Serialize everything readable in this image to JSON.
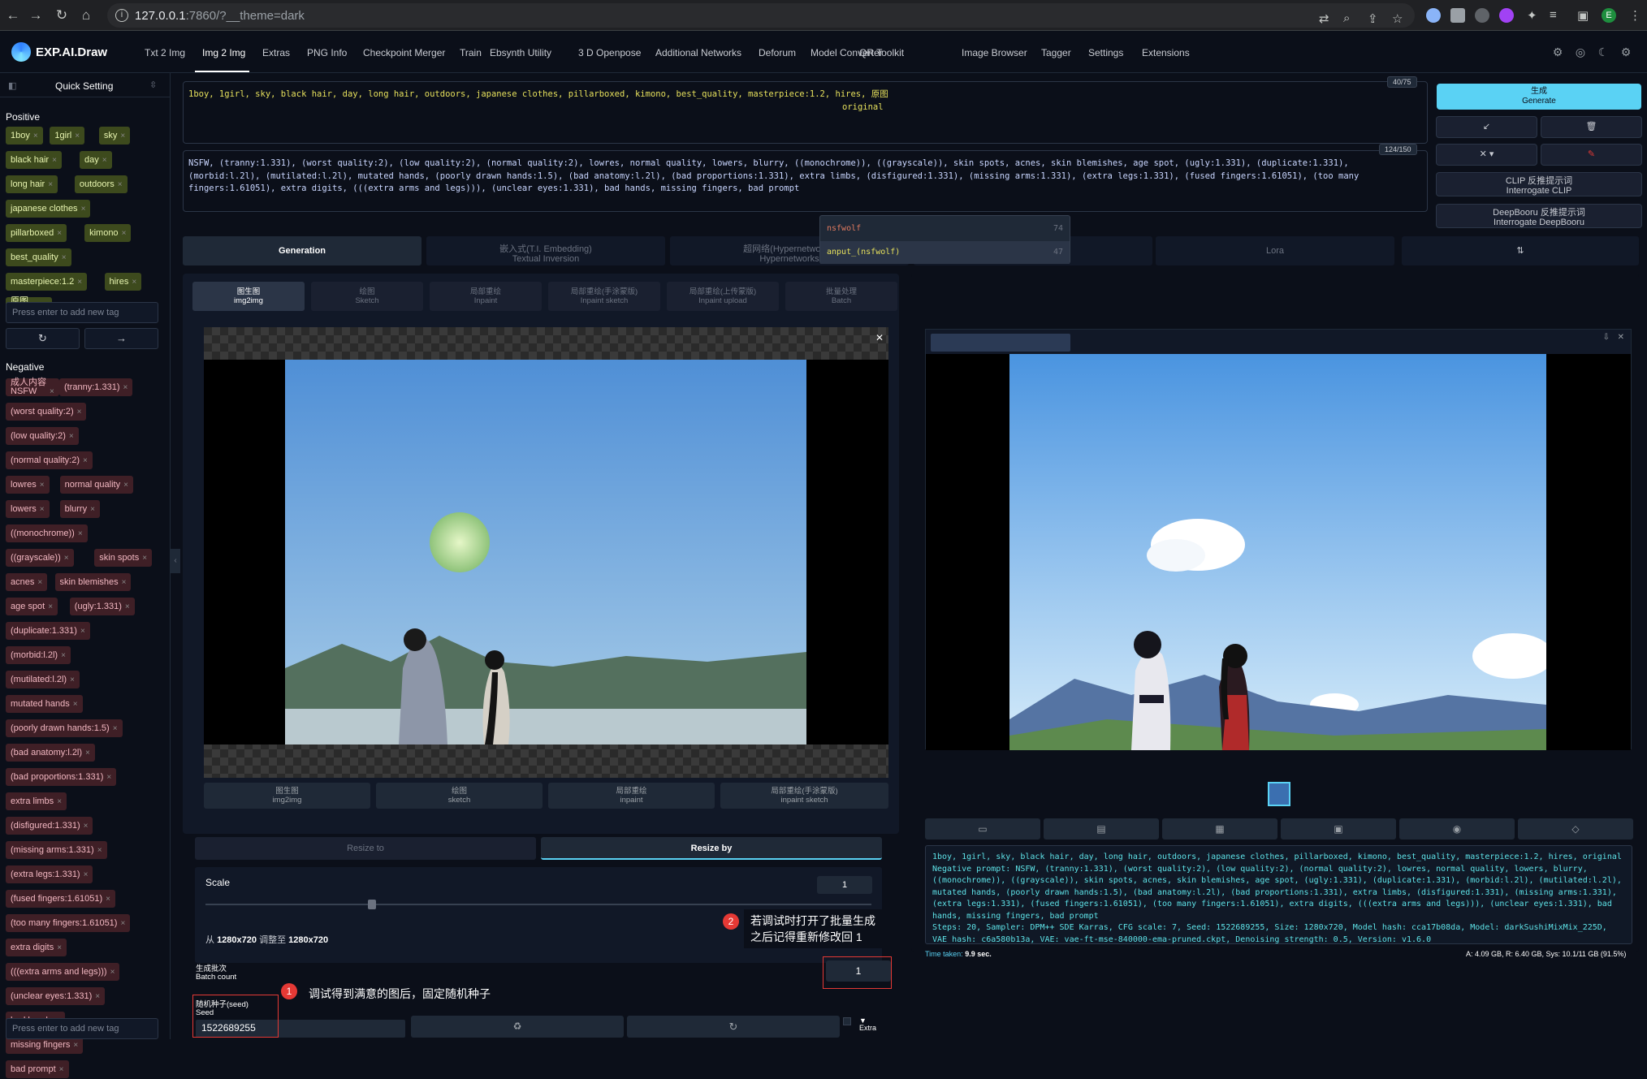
{
  "browser": {
    "url_host": "127.0.0.1",
    "url_rest": ":7860/?__theme=dark",
    "profile_initial": "E"
  },
  "app": {
    "brand": "EXP.AI.Draw",
    "tabs": [
      "Txt 2 Img",
      "Img 2 Img",
      "Extras",
      "PNG Info",
      "Checkpoint Merger",
      "Train",
      "Ebsynth Utility",
      "3 D Openpose",
      "Additional Networks",
      "Deforum",
      "Model Converter",
      "QR Toolkit",
      "Image Browser",
      "Tagger",
      "Settings",
      "Extensions"
    ],
    "active_tab": "Img 2 Img"
  },
  "sidebar": {
    "title": "Quick Setting",
    "positive_label": "Positive",
    "negative_label": "Negative",
    "positive_tags": [
      "1boy",
      "1girl",
      "sky",
      "black hair",
      "day",
      "long hair",
      "outdoors",
      "japanese clothes",
      "pillarboxed",
      "kimono",
      "best_quality",
      "masterpiece:1.2",
      "hires",
      "原图 original"
    ],
    "negative_tags": [
      "成人内容 NSFW",
      "(tranny:1.331)",
      "(worst quality:2)",
      "(low quality:2)",
      "(normal quality:2)",
      "lowres",
      "normal quality",
      "lowers",
      "blurry",
      "((monochrome))",
      "((grayscale))",
      "skin spots",
      "acnes",
      "skin blemishes",
      "age spot",
      "(ugly:1.331)",
      "(duplicate:1.331)",
      "(morbid:l.2l)",
      "(mutilated:l.2l)",
      "mutated hands",
      "(poorly drawn hands:1.5)",
      "(bad anatomy:l.2l)",
      "(bad proportions:1.331)",
      "extra limbs",
      "(disfigured:1.331)",
      "(missing arms:1.331)",
      "(extra legs:1.331)",
      "(fused fingers:1.61051)",
      "(too many fingers:1.61051)",
      "extra digits",
      "(((extra arms and legs)))",
      "(unclear eyes:1.331)",
      "bad hands",
      "missing fingers",
      "bad prompt"
    ],
    "add_placeholder": "Press enter to add new tag"
  },
  "prompt": {
    "positive": "1boy, 1girl, sky, black hair, day, long hair, outdoors, japanese clothes, pillarboxed, kimono, best_quality, masterpiece:1.2, hires, 原图",
    "positive_tail": "original",
    "positive_counter": "40/75",
    "negative": "NSFW, (tranny:1.331), (worst quality:2), (low quality:2), (normal quality:2), lowres, normal quality, lowers, blurry, ((monochrome)), ((grayscale)), skin spots, acnes, skin blemishes, age spot, (ugly:1.331), (duplicate:1.331), (morbid:l.2l), (mutilated:l.2l), mutated hands, (poorly drawn hands:1.5), (bad anatomy:l.2l), (bad proportions:1.331), extra limbs, (disfigured:1.331), (missing arms:1.331), (extra legs:1.331), (fused fingers:1.61051), (too many fingers:1.61051), extra digits, (((extra arms and legs))), (unclear eyes:1.331), bad hands, missing fingers, bad prompt",
    "negative_counter": "124/150"
  },
  "actions": {
    "generate_cn": "生成",
    "generate_en": "Generate",
    "clip_cn": "CLIP 反推提示词",
    "clip_en": "Interrogate CLIP",
    "deepbooru_cn": "DeepBooru 反推提示词",
    "deepbooru_en": "Interrogate DeepBooru"
  },
  "autocomplete": [
    {
      "text": "nsfwolf",
      "count": "74"
    },
    {
      "text": "anput_(nsfwolf)",
      "count": "47"
    }
  ],
  "extra_tabs": [
    {
      "label": "Generation"
    },
    {
      "cn": "嵌入式(T.I. Embedding)",
      "en": "Textual Inversion"
    },
    {
      "cn": "超网络(Hypernetworks)",
      "en": "Hypernetworks"
    },
    {
      "label": "Lora"
    }
  ],
  "img2img_tabs": [
    {
      "cn": "图生图",
      "en": "img2img"
    },
    {
      "cn": "绘图",
      "en": "Sketch"
    },
    {
      "cn": "局部重绘",
      "en": "Inpaint"
    },
    {
      "cn": "局部重绘(手涂蒙版)",
      "en": "Inpaint sketch"
    },
    {
      "cn": "局部重绘(上传蒙版)",
      "en": "Inpaint upload"
    },
    {
      "cn": "批量处理",
      "en": "Batch"
    }
  ],
  "copy_to": [
    {
      "cn": "图生图",
      "en": "img2img"
    },
    {
      "cn": "绘图",
      "en": "sketch"
    },
    {
      "cn": "局部重绘",
      "en": "inpaint"
    },
    {
      "cn": "局部重绘(手涂蒙版)",
      "en": "inpaint sketch"
    }
  ],
  "resize": {
    "resize_to": "Resize to",
    "resize_by": "Resize by",
    "scale_label": "Scale",
    "scale_value": "1",
    "scale_fraction": 0.25,
    "from_label": "从",
    "from_size": "1280x720",
    "to_label": "调整至",
    "to_size": "1280x720"
  },
  "batch": {
    "label_cn": "生成批次",
    "label_en": "Batch count",
    "value": "1"
  },
  "seed": {
    "label_cn": "随机种子(seed)",
    "label_en": "Seed",
    "value": "1522689255",
    "extra_label": "Extra"
  },
  "annotations": [
    {
      "num": "1",
      "text": "调试得到满意的图后，固定随机种子"
    },
    {
      "num": "2",
      "line1": "若调试时打开了批量生成",
      "line2": "之后记得重新修改回 1"
    }
  ],
  "output": {
    "info": "1boy, 1girl, sky, black hair, day, long hair, outdoors, japanese clothes, pillarboxed, kimono, best_quality, masterpiece:1.2, hires, original\nNegative prompt: NSFW, (tranny:1.331), (worst quality:2), (low quality:2), (normal quality:2), lowres, normal quality, lowers, blurry, ((monochrome)), ((grayscale)), skin spots, acnes, skin blemishes, age spot, (ugly:1.331), (duplicate:1.331), (morbid:l.2l), (mutilated:l.2l), mutated hands, (poorly drawn hands:1.5), (bad anatomy:l.2l), (bad proportions:1.331), extra limbs, (disfigured:1.331), (missing arms:1.331), (extra legs:1.331), (fused fingers:1.61051), (too many fingers:1.61051), extra digits, (((extra arms and legs))), (unclear eyes:1.331), bad hands, missing fingers, bad prompt\nSteps: 20, Sampler: DPM++ SDE Karras, CFG scale: 7, Seed: 1522689255, Size: 1280x720, Model hash: cca17b08da, Model: darkSushiMixMix_225D, VAE hash: c6a580b13a, VAE: vae-ft-mse-840000-ema-pruned.ckpt, Denoising strength: 0.5, Version: v1.6.0",
    "time_label": "Time taken:",
    "time_value": "9.9 sec.",
    "mem": "A: 4.09 GB, R: 6.40 GB, Sys: 10.1/11 GB (91.5%)"
  },
  "colors": {
    "accent": "#5ad2f4",
    "positive_tag_bg": "#3d4a1d",
    "negative_tag_bg": "#3f1f26",
    "annotation_red": "#e53935"
  }
}
